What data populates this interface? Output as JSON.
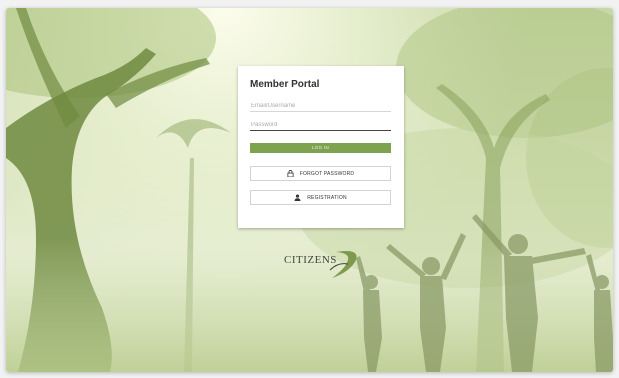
{
  "portal": {
    "title": "Member Portal",
    "email_placeholder": "Email/Username",
    "password_placeholder": "Password",
    "login_label": "LOG IN",
    "forgot_label": "FORGOT PASSWORD",
    "register_label": "REGISTRATION"
  },
  "brand": {
    "logo_text": "CITIZENS",
    "logo_icon": "swoosh-logo-mark"
  },
  "colors": {
    "accent_green": "#7ea34f",
    "background_tint": "#d6e2b9"
  },
  "icons": {
    "forgot": "lock-icon",
    "register": "user-icon"
  }
}
